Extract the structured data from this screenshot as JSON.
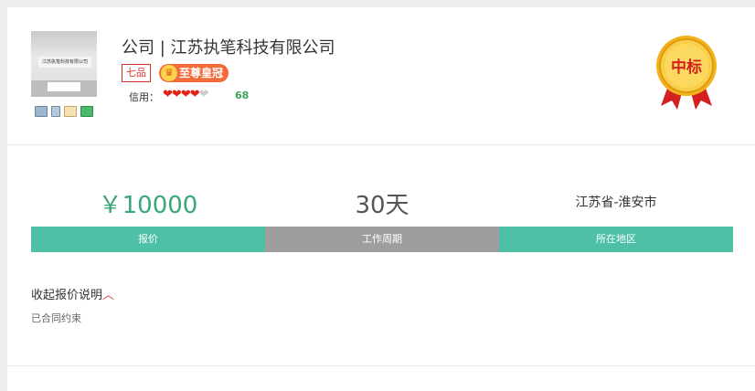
{
  "company": {
    "name": "公司 | 江苏执笔科技有限公司",
    "logo_sign_text": "江苏执笔科技有限公司",
    "grade_badge": "七品",
    "membership_badge": "至尊皇冠",
    "credit_label": "信用：",
    "credit_hearts": {
      "filled": 4,
      "total": 5
    },
    "credit_score": "68",
    "verification_icons": [
      "id-card-icon",
      "phone-icon",
      "email-icon",
      "business-card-icon"
    ]
  },
  "medal": {
    "label": "中标",
    "colors": {
      "gold": "#f2b21b",
      "red": "#d42020"
    }
  },
  "stats": {
    "price_value": "￥10000",
    "period_value": "30天",
    "region_value": "江苏省-淮安市",
    "price_label": "报价",
    "period_label": "工作周期",
    "region_label": "所在地区"
  },
  "quote": {
    "toggle_label": "收起报价说明",
    "toggle_icon": "chevron-up-icon",
    "note": "已合同约束"
  },
  "colors": {
    "accent_green": "#4dc0a7",
    "gray_bar": "#9e9e9e",
    "price_green": "#3aa77a",
    "badge_red": "#d9342b",
    "crown_orange": "#f36b3a"
  }
}
